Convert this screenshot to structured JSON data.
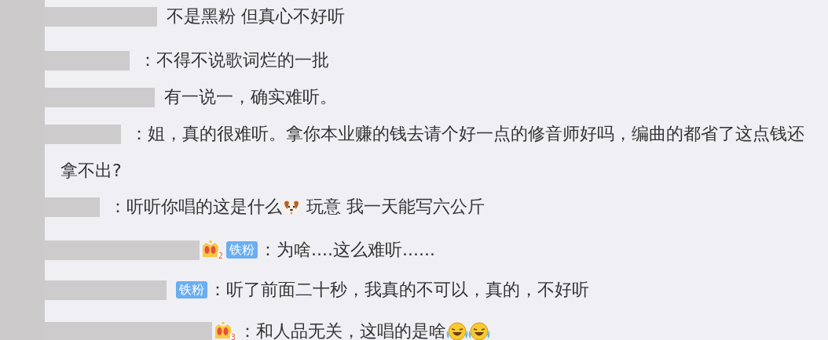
{
  "comments": [
    {
      "segments": [
        {
          "kind": "text",
          "text": "不是黑粉 但真心不好听"
        }
      ]
    },
    {
      "segments": [
        {
          "kind": "text",
          "text": "：不得不说歌词烂的一批"
        }
      ]
    },
    {
      "segments": [
        {
          "kind": "text",
          "text": "有一说一，确实难听。"
        }
      ]
    },
    {
      "segments": [
        {
          "kind": "text",
          "text": "：姐，真的很难听。拿你本业赚的钱去请个好一点的修音师好吗，编曲的都省了这点钱还"
        }
      ],
      "continuation": "拿不出?"
    },
    {
      "segments": [
        {
          "kind": "text",
          "text": "：听听你唱的这是什么"
        },
        {
          "kind": "dog"
        },
        {
          "kind": "text",
          "text": " 玩意 我一天能写六公斤"
        }
      ]
    },
    {
      "crown": "2",
      "badge": "铁粉",
      "segments": [
        {
          "kind": "text",
          "text": "：为啥....这么难听......"
        }
      ]
    },
    {
      "badge": "铁粉",
      "segments": [
        {
          "kind": "text",
          "text": "：听了前面二十秒，我真的不可以，真的，不好听"
        }
      ]
    },
    {
      "crown": "3",
      "segments": [
        {
          "kind": "text",
          "text": "：和人品无关，这唱的是啥"
        },
        {
          "kind": "laugh"
        },
        {
          "kind": "laugh"
        }
      ]
    }
  ]
}
